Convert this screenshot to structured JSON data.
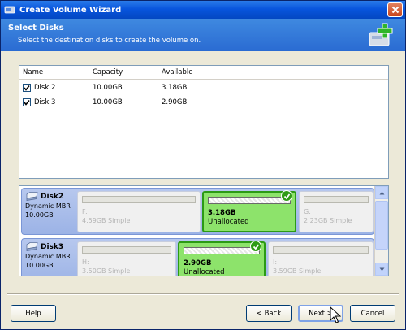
{
  "window": {
    "title": "Create Volume Wizard",
    "close_icon": "close-icon"
  },
  "header": {
    "title": "Select Disks",
    "subtitle": "Select the destination disks to create the volume on."
  },
  "table": {
    "columns": [
      "Name",
      "Capacity",
      "Available"
    ],
    "rows": [
      {
        "checked": true,
        "name": "Disk 2",
        "capacity": "10.00GB",
        "available": "3.18GB"
      },
      {
        "checked": true,
        "name": "Disk 3",
        "capacity": "10.00GB",
        "available": "2.90GB"
      }
    ]
  },
  "disks": [
    {
      "name": "Disk2",
      "type": "Dynamic MBR",
      "size": "10.00GB",
      "partitions": [
        {
          "label": "F:",
          "detail": "4.59GB Simple",
          "selected": false
        },
        {
          "label": "3.18GB",
          "detail": "Unallocated",
          "selected": true
        },
        {
          "label": "G:",
          "detail": "2.23GB Simple",
          "selected": false
        }
      ]
    },
    {
      "name": "Disk3",
      "type": "Dynamic MBR",
      "size": "10.00GB",
      "partitions": [
        {
          "label": "H:",
          "detail": "3.50GB Simple",
          "selected": false
        },
        {
          "label": "2.90GB",
          "detail": "Unallocated",
          "selected": true
        },
        {
          "label": "I:",
          "detail": "3.59GB Simple",
          "selected": false
        }
      ]
    }
  ],
  "buttons": {
    "help": "Help",
    "back": "< Back",
    "next": "Next >",
    "cancel": "Cancel"
  },
  "colors": {
    "titlebar": "#0855dd",
    "header": "#3f89e0",
    "selected_partition": "#8de36b",
    "selected_border": "#2b9a15"
  }
}
